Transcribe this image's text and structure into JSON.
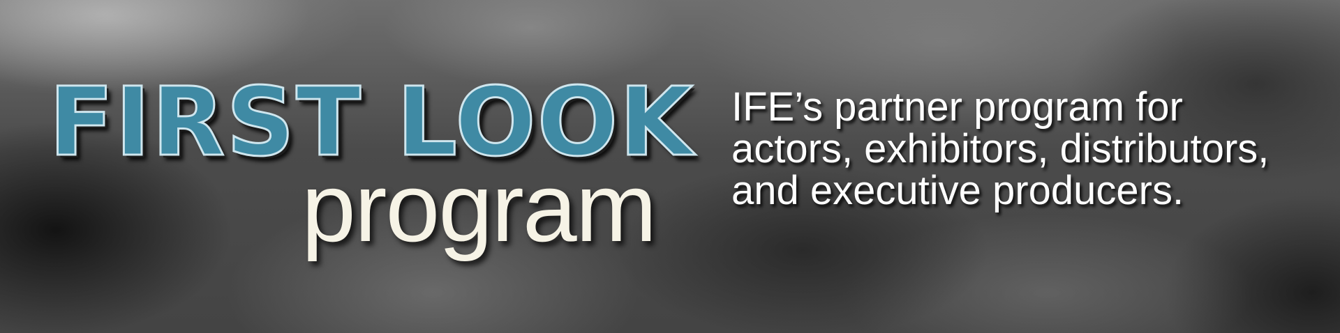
{
  "banner": {
    "headline": "FIRST LOOK",
    "subhead": "program",
    "tagline_lines": [
      "IFE’s partner program for",
      "actors, exhibitors, distributors,",
      "and executive producers."
    ]
  },
  "colors": {
    "headline_fill": "#3f8aa4",
    "headline_outline": "#cfe6ee",
    "subhead": "#f6f3e6",
    "tagline": "#ffffff"
  }
}
